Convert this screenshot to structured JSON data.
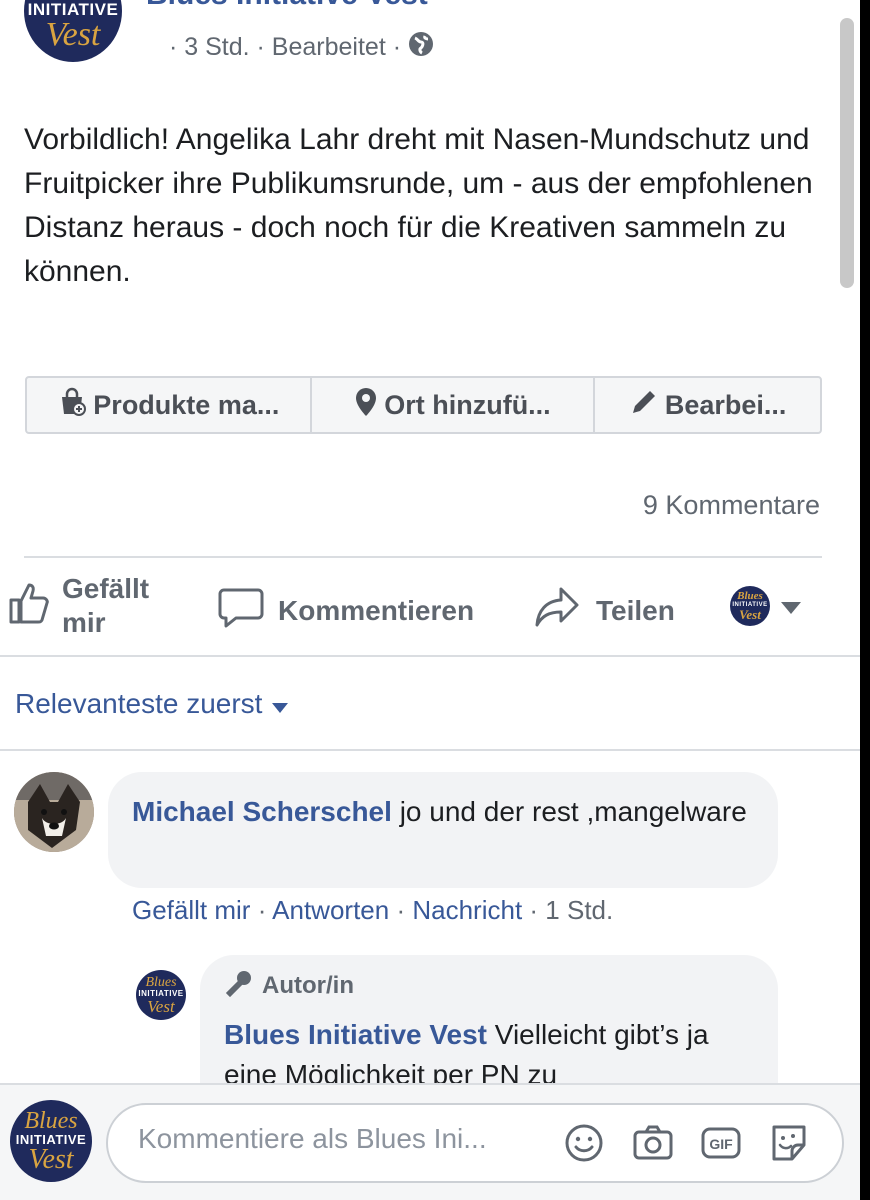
{
  "post": {
    "author": "Blues Initiative Vest",
    "time": "· 3 Std. · Bearbeitet ·",
    "text": "Vorbildlich! Angelika Lahr dreht mit Nasen-Mundschutz und Fruitpicker ihre Publikumsrunde, um - aus der empfohlenen Distanz heraus - doch noch für die Kreativen sammeln zu können.",
    "avatar_lines": [
      "Blues",
      "INITIATIVE",
      "Vest"
    ]
  },
  "tags": [
    {
      "label": "Produkte ma...",
      "icon": "shopping-bag-icon"
    },
    {
      "label": "Ort hinzufü...",
      "icon": "location-pin-icon"
    },
    {
      "label": "Bearbei...",
      "icon": "pencil-icon"
    }
  ],
  "comments_count": "9 Kommentare",
  "actions": {
    "like": "Gefällt mir",
    "comment": "Kommentieren",
    "share": "Teilen"
  },
  "sort": {
    "label": "Relevanteste zuerst"
  },
  "comments": [
    {
      "author": "Michael Scherschel",
      "text": "jo und der rest ,mangelware",
      "like": "Gefällt mir",
      "reply": "Antworten",
      "message": "Nachricht",
      "time": "· 1 Std."
    }
  ],
  "replies": [
    {
      "badge": "Autor/in",
      "author": "Blues Initiative Vest",
      "text": "Vielleicht gibt’s ja eine Möglichkeit per PN zu"
    }
  ],
  "composer": {
    "placeholder": "Kommentiere als Blues Ini..."
  },
  "colors": {
    "link": "#385898",
    "muted": "#606770",
    "bubble": "#f2f3f5",
    "logo_bg": "#1f2a5c"
  }
}
